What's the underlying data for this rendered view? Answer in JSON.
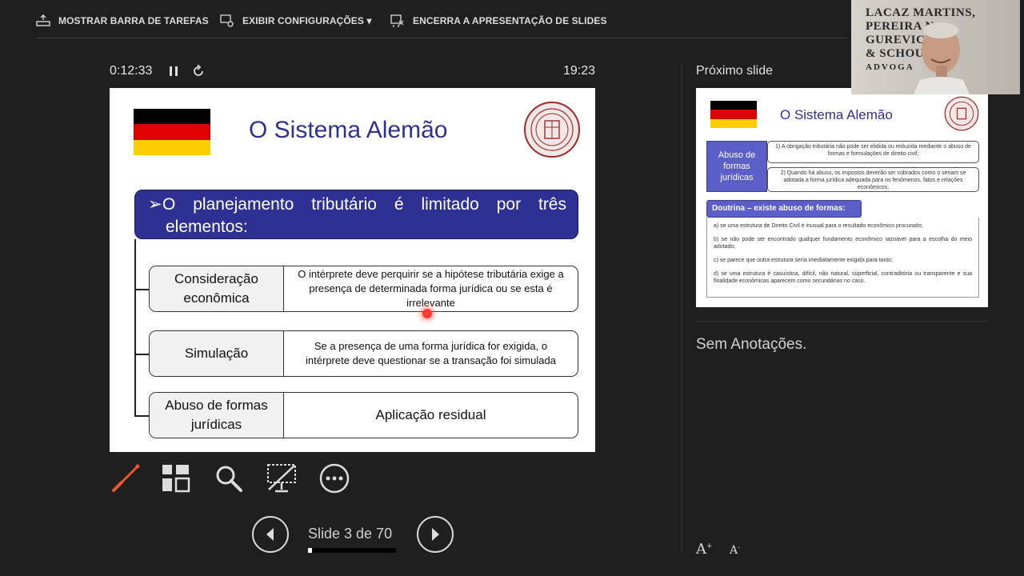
{
  "toolbar": {
    "taskbar_label": "MOSTRAR BARRA DE TAREFAS",
    "settings_label": "EXIBIR CONFIGURAÇÕES ▾",
    "end_label": "ENCERRA A APRESENTAÇÃO DE SLIDES"
  },
  "timer": {
    "elapsed": "0:12:33",
    "clock": "19:23"
  },
  "current_slide": {
    "title": "O Sistema Alemão",
    "banner_line1": "O planejamento tributário é limitado por três",
    "banner_line2": "elementos:",
    "rows": [
      {
        "label": "Consideração econômica",
        "desc": "O intérprete deve perquirir se a hipótese tributária exige a presença de determinada forma jurídica ou se esta é irrelevante"
      },
      {
        "label": "Simulação",
        "desc": "Se a presença de uma forma jurídica for exigida, o intérprete deve questionar se a transação foi simulada"
      },
      {
        "label": "Abuso de formas jurídicas",
        "desc": "Aplicação residual"
      }
    ]
  },
  "navigation": {
    "slide_counter": "Slide 3 de 70",
    "progress": 0.043
  },
  "right_pane": {
    "next_label": "Próximo slide",
    "next_slide": {
      "title": "O Sistema Alemão",
      "abuse_label": "Abuso de formas jurídicas",
      "box1": "1) A obrigação tributária não pode ser elidida ou reduzida mediante o abuso de formas e formulações de direito civil;",
      "box2": "2) Quando há abuso, os impostos deverão ser cobrados como o seriam se adotada a forma jurídica adequada para os fenômenos, fatos e relações econômicos.",
      "doutrina": "Doutrina – existe abuso de formas:",
      "items": [
        "a) se uma estrutura de Direito Civil é inusual para o resultado econômico procurado;",
        "b) se não pode ser encontrado qualquer fundamento econômico razoável para a escolha do meio adotado;",
        "c) se parece que outra estrutura seria imediatamente exigida para tanto;",
        "d) se uma estrutura é casuística, difícil, não natural, superficial, contraditória ou transparente e sua finalidade econômicas aparecem como secundárias no caso."
      ]
    },
    "notes": "Sem Anotações."
  },
  "webcam": {
    "logo_lines": [
      "LACAZ MARTINS,",
      "PEREIRA N",
      "GUREVIC",
      "& SCHOU",
      "ADVOGA"
    ]
  },
  "icons": [
    "taskbar-icon",
    "settings-icon",
    "end-slideshow-icon",
    "pause-icon",
    "reset-icon",
    "pen-icon",
    "all-slides-icon",
    "zoom-icon",
    "screen-icon",
    "more-icon",
    "prev-icon",
    "next-icon",
    "font-increase-icon",
    "font-decrease-icon"
  ],
  "colors": {
    "background": "#1f1f1f",
    "slide_title": "#2e3192",
    "banner": "#2e3192",
    "pen": "#e8582d"
  }
}
